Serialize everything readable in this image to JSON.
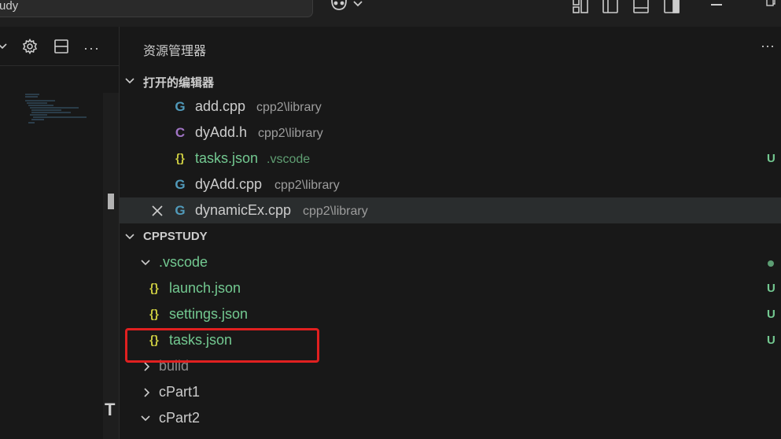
{
  "titlebar": {
    "search_text": "udy"
  },
  "left_panel": {
    "more_label": "···",
    "t_mark": "T"
  },
  "explorer": {
    "title": "资源管理器",
    "more_label": "···",
    "open_editors": {
      "label": "打开的编辑器",
      "items": [
        {
          "name": "add.cpp",
          "path": "cpp2\\library",
          "icon": "cpp-icon",
          "icon_glyph": "G",
          "status": ""
        },
        {
          "name": "dyAdd.h",
          "path": "cpp2\\library",
          "icon": "c-header-icon",
          "icon_glyph": "C",
          "status": ""
        },
        {
          "name": "tasks.json",
          "path": ".vscode",
          "icon": "json-icon",
          "icon_glyph": "{}",
          "status": "U"
        },
        {
          "name": "dyAdd.cpp",
          "path": "cpp2\\library",
          "icon": "cpp-icon",
          "icon_glyph": "G",
          "status": ""
        },
        {
          "name": "dynamicEx.cpp",
          "path": "cpp2\\library",
          "icon": "cpp-icon",
          "icon_glyph": "G",
          "status": ""
        }
      ]
    },
    "workspace": {
      "label": "CPPSTUDY",
      "tree": [
        {
          "name": ".vscode",
          "kind": "folder-open",
          "status": "dot"
        },
        {
          "name": "launch.json",
          "icon_glyph": "{}",
          "status": "U"
        },
        {
          "name": "settings.json",
          "icon_glyph": "{}",
          "status": "U"
        },
        {
          "name": "tasks.json",
          "icon_glyph": "{}",
          "status": "U"
        },
        {
          "name": "build",
          "kind": "folder-closed",
          "status": ""
        },
        {
          "name": "cPart1",
          "kind": "folder-closed",
          "status": ""
        },
        {
          "name": "cPart2",
          "kind": "folder-open",
          "status": ""
        }
      ]
    }
  },
  "colors": {
    "background": "#181818",
    "selected_row": "#2a2d2e",
    "git_untracked": "#73c991",
    "cpp_icon": "#519aba",
    "h_icon": "#a074c4",
    "json_icon": "#cbcb41",
    "highlight_box": "#e02020"
  }
}
